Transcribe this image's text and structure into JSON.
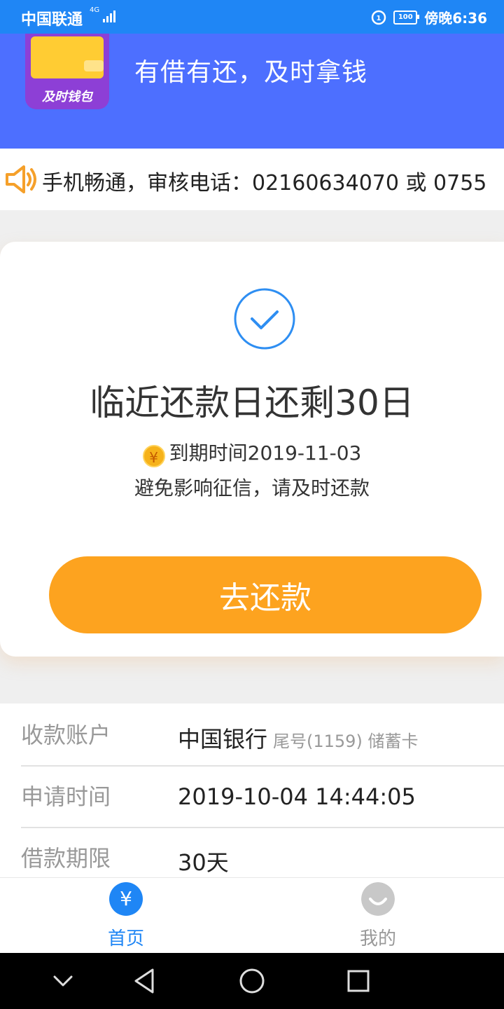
{
  "status_bar": {
    "carrier": "中国联通",
    "network": "4G",
    "time": "傍晚6:36",
    "battery": "100"
  },
  "header": {
    "logo_text": "及时钱包",
    "slogan": "有借有还，及时拿钱"
  },
  "notice": {
    "text": "手机畅通，审核电话：02160634070 或 0755"
  },
  "card": {
    "title": "临近还款日还剩30日",
    "due_text": "到期时间2019-11-03",
    "hint": "避免影响征信，请及时还款",
    "button": "去还款",
    "coin_symbol": "¥"
  },
  "info": {
    "rows": [
      {
        "label": "收款账户",
        "value": "中国银行",
        "sub": "尾号(1159) 储蓄卡"
      },
      {
        "label": "申请时间",
        "value": "2019-10-04 14:44:05",
        "sub": ""
      },
      {
        "label": "借款期限",
        "value": "30天",
        "sub": ""
      }
    ]
  },
  "tabbar": {
    "tabs": [
      {
        "label": "首页",
        "icon": "yen-icon",
        "active": true,
        "glyph": "¥"
      },
      {
        "label": "我的",
        "icon": "smile-icon",
        "active": false
      }
    ]
  },
  "colors": {
    "status_bar": "#1f86f5",
    "header": "#4d6fff",
    "accent": "#fda31f",
    "active_tab": "#1f86f5",
    "inactive_tab": "#999999"
  }
}
